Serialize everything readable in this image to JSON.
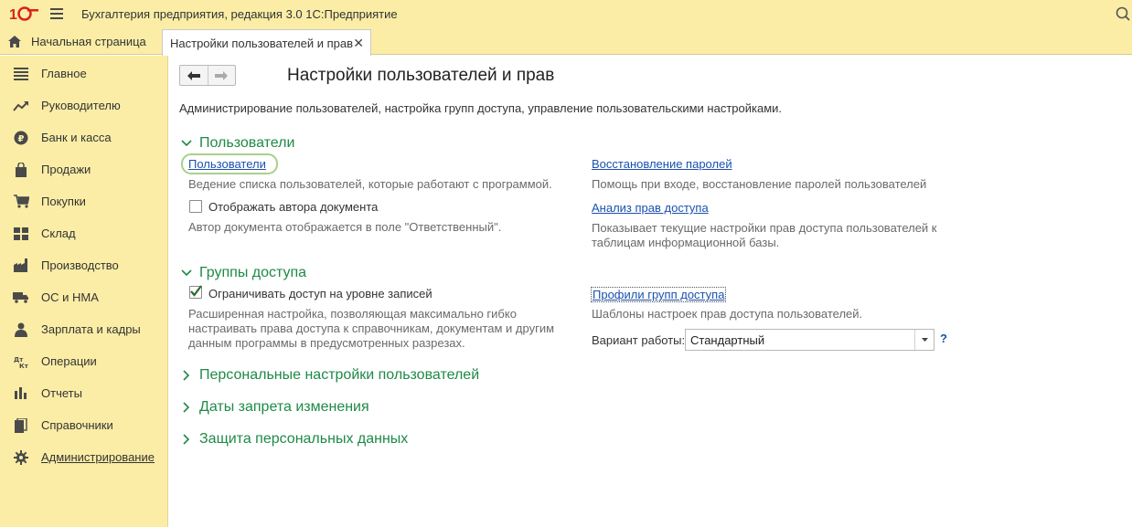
{
  "app": {
    "title": "Бухгалтерия предприятия, редакция 3.0 1С:Предприятие"
  },
  "tabs": {
    "home_label": "Начальная страница",
    "active_label": "Настройки пользователей и прав",
    "close_glyph": "✕"
  },
  "sidebar": {
    "items": [
      {
        "label": "Главное",
        "icon": "menu-lines-icon"
      },
      {
        "label": "Руководителю",
        "icon": "trend-chart-icon"
      },
      {
        "label": "Банк и касса",
        "icon": "ruble-coin-icon"
      },
      {
        "label": "Продажи",
        "icon": "shopping-bag-icon"
      },
      {
        "label": "Покупки",
        "icon": "cart-icon"
      },
      {
        "label": "Склад",
        "icon": "warehouse-grid-icon"
      },
      {
        "label": "Производство",
        "icon": "factory-icon"
      },
      {
        "label": "ОС и НМА",
        "icon": "truck-icon"
      },
      {
        "label": "Зарплата и кадры",
        "icon": "person-icon"
      },
      {
        "label": "Операции",
        "icon": "debit-credit-icon"
      },
      {
        "label": "Отчеты",
        "icon": "bar-report-icon"
      },
      {
        "label": "Справочники",
        "icon": "book-icon"
      },
      {
        "label": "Администрирование",
        "icon": "gear-icon"
      }
    ]
  },
  "page": {
    "title": "Настройки пользователей и прав",
    "description": "Администрирование пользователей, настройка групп доступа, управление пользовательскими настройками."
  },
  "sections": {
    "users": {
      "title": "Пользователи",
      "users_link": "Пользователи",
      "users_hint": "Ведение списка пользователей, которые работают с программой.",
      "show_author_label": "Отображать автора документа",
      "show_author_checked": false,
      "show_author_hint": "Автор документа отображается в поле \"Ответственный\".",
      "restore_link": "Восстановление паролей",
      "restore_hint": "Помощь при входе, восстановление паролей пользователей",
      "analysis_link": "Анализ прав доступа",
      "analysis_hint_1": "Показывает текущие настройки прав доступа пользователей к",
      "analysis_hint_2": "таблицам информационной базы."
    },
    "groups": {
      "title": "Группы доступа",
      "restrict_label": "Ограничивать доступ на уровне записей",
      "restrict_checked": true,
      "restrict_hint_1": "Расширенная настройка, позволяющая максимально гибко",
      "restrict_hint_2": "настраивать права доступа к справочникам, документам и другим",
      "restrict_hint_3": "данным программы в предусмотренных разрезах.",
      "profiles_link": "Профили групп доступа",
      "profiles_hint": "Шаблоны настроек прав доступа пользователей.",
      "mode_label": "Вариант работы:",
      "mode_value": "Стандартный",
      "help_glyph": "?"
    },
    "personal": {
      "title": "Персональные настройки пользователей"
    },
    "dates": {
      "title": "Даты запрета изменения"
    },
    "privacy": {
      "title": "Защита персональных данных"
    }
  },
  "colors": {
    "panel": "#fbeda6",
    "section_green": "#1e8a47",
    "link_blue": "#1a50b0"
  }
}
